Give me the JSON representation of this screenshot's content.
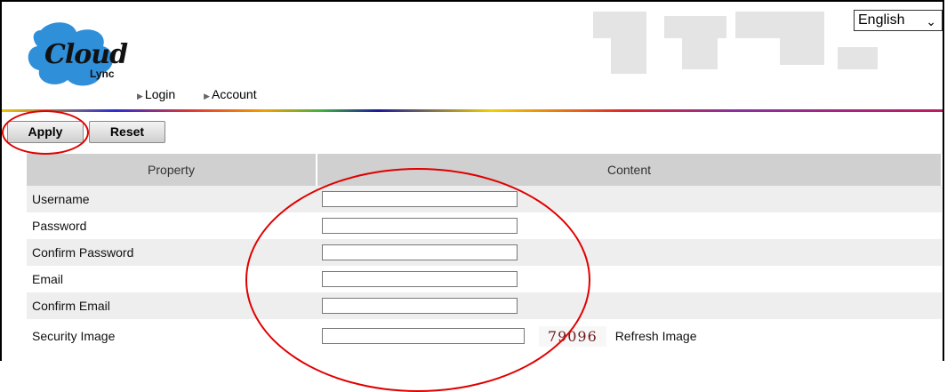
{
  "header": {
    "language": {
      "selected": "English"
    },
    "logo": {
      "text": "Cloud",
      "sub": "Lync"
    },
    "nav": [
      {
        "label": "Login"
      },
      {
        "label": "Account"
      }
    ]
  },
  "toolbar": {
    "apply_label": "Apply",
    "reset_label": "Reset"
  },
  "form": {
    "columns": [
      "Property",
      "Content"
    ],
    "rows": [
      {
        "label": "Username",
        "value": ""
      },
      {
        "label": "Password",
        "value": ""
      },
      {
        "label": "Confirm Password",
        "value": ""
      },
      {
        "label": "Email",
        "value": ""
      },
      {
        "label": "Confirm Email",
        "value": ""
      },
      {
        "label": "Security Image",
        "value": "",
        "captcha": "79096",
        "refresh": "Refresh Image"
      }
    ]
  },
  "colors": {
    "annotation": "#e00000",
    "header_gray": "#d0d0d0"
  }
}
